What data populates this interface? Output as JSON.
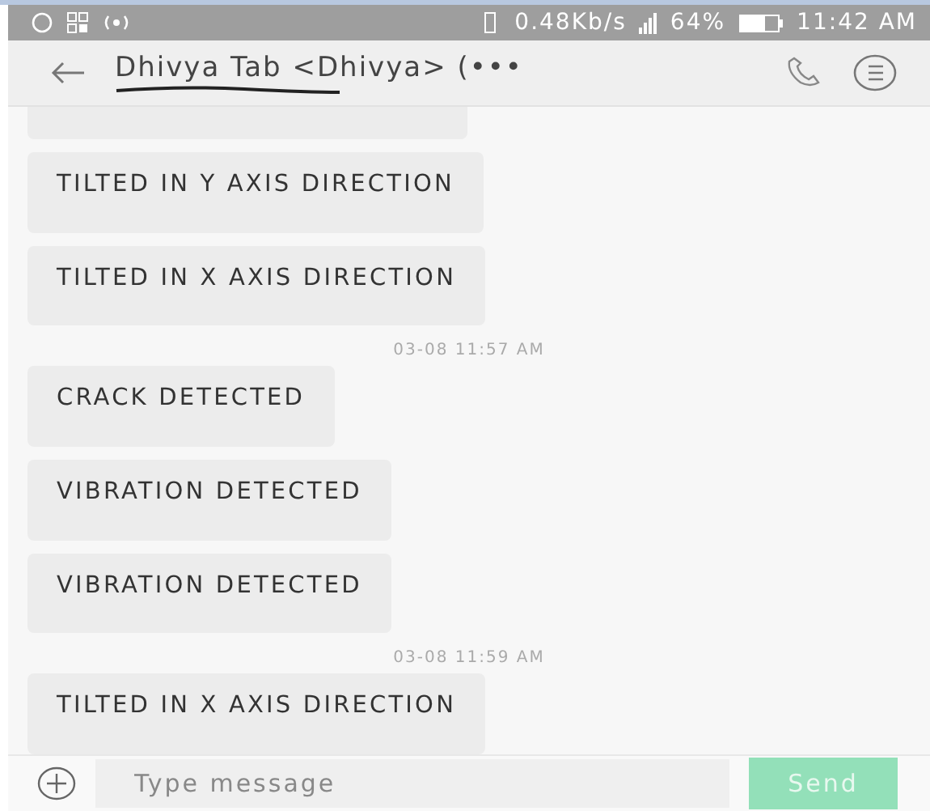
{
  "status_bar": {
    "speed": "0.48Kb/s",
    "battery": "64%",
    "time": "11:42 AM"
  },
  "header": {
    "title": "Dhivya Tab <Dhivya> (•••"
  },
  "messages": [
    {
      "kind": "partial"
    },
    {
      "kind": "message",
      "text": "TILTED IN Y AXIS DIRECTION"
    },
    {
      "kind": "message",
      "text": "TILTED IN X AXIS DIRECTION"
    },
    {
      "kind": "timestamp",
      "text": "03-08 11:57 AM"
    },
    {
      "kind": "message",
      "text": "CRACK DETECTED"
    },
    {
      "kind": "message",
      "text": "VIBRATION DETECTED"
    },
    {
      "kind": "message",
      "text": "VIBRATION DETECTED"
    },
    {
      "kind": "timestamp",
      "text": "03-08 11:59 AM"
    },
    {
      "kind": "message",
      "text": "TILTED IN X AXIS DIRECTION"
    }
  ],
  "composer": {
    "placeholder": "Type message",
    "send": "Send"
  }
}
